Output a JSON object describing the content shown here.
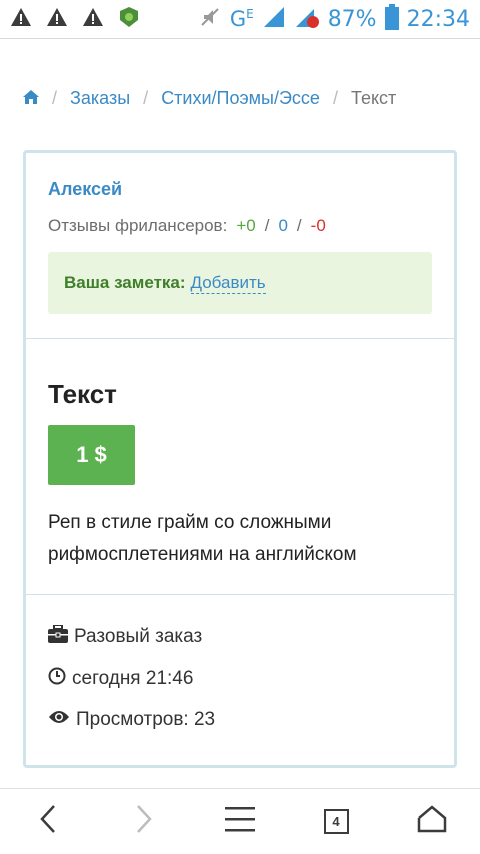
{
  "status_bar": {
    "network": "G",
    "network_sub": "E",
    "battery_percent": "87%",
    "time": "22:34"
  },
  "breadcrumb": {
    "home_icon": "home-icon",
    "items": [
      "Заказы",
      "Стихи/Поэмы/Эссе"
    ],
    "current": "Текст"
  },
  "card": {
    "author": "Алексей",
    "reviews_label": "Отзывы фрилансеров:",
    "reviews_positive": "+0",
    "reviews_neutral": "0",
    "reviews_negative": "-0",
    "reviews_sep": "/",
    "note_label": "Ваша заметка:",
    "note_action": "Добавить",
    "title": "Текст",
    "price": "1 $",
    "description": "Реп в стиле грайм со сложными рифмосплетениями на английском",
    "order_type": "Разовый заказ",
    "posted": "сегодня 21:46",
    "views": "Просмотров: 23"
  },
  "browser_nav": {
    "tabs_count": "4"
  },
  "colors": {
    "link": "#3a8ac6",
    "price_bg": "#5cb150",
    "note_bg": "#eaf5df",
    "card_border": "#cfe4ea"
  }
}
